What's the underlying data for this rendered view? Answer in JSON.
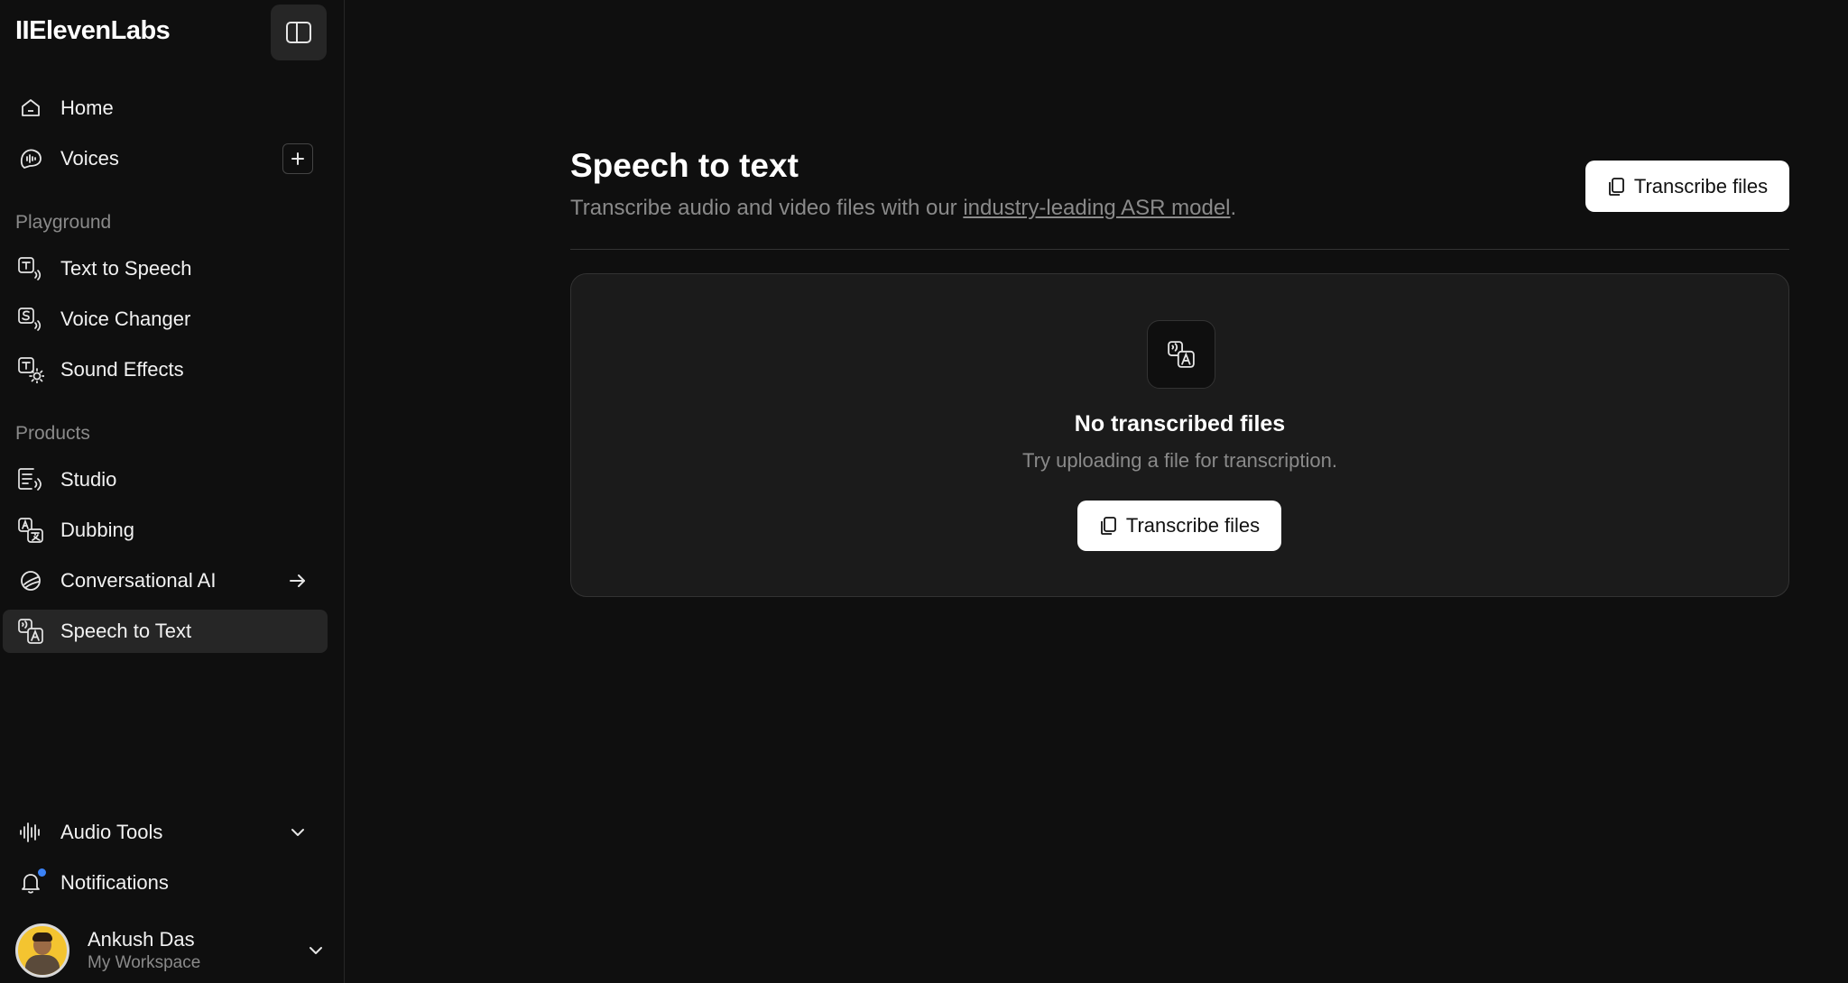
{
  "app": {
    "logo": "IIElevenLabs"
  },
  "sidebar": {
    "items": [
      {
        "label": "Home",
        "icon": "home-icon"
      },
      {
        "label": "Voices",
        "icon": "voices-icon",
        "trail": "plus-icon"
      }
    ],
    "sections": [
      {
        "title": "Playground",
        "items": [
          {
            "label": "Text to Speech",
            "icon": "text-to-speech-icon"
          },
          {
            "label": "Voice Changer",
            "icon": "voice-changer-icon"
          },
          {
            "label": "Sound Effects",
            "icon": "sound-effects-icon"
          }
        ]
      },
      {
        "title": "Products",
        "items": [
          {
            "label": "Studio",
            "icon": "studio-icon"
          },
          {
            "label": "Dubbing",
            "icon": "dubbing-icon"
          },
          {
            "label": "Conversational AI",
            "icon": "conversational-ai-icon",
            "trail": "arrow-right-icon"
          },
          {
            "label": "Speech to Text",
            "icon": "speech-to-text-icon",
            "active": true
          }
        ]
      }
    ],
    "bottom": [
      {
        "label": "Audio Tools",
        "icon": "audio-tools-icon",
        "trail": "chevron-down-icon"
      },
      {
        "label": "Notifications",
        "icon": "bell-icon",
        "badge_color": "#3b82f6"
      }
    ],
    "user": {
      "name": "Ankush Das",
      "workspace": "My Workspace"
    }
  },
  "main": {
    "title": "Speech to text",
    "subtitle_prefix": "Transcribe audio and video files with our ",
    "subtitle_link": "industry-leading ASR model",
    "subtitle_suffix": ".",
    "header_button": "Transcribe files",
    "empty_state": {
      "title": "No transcribed files",
      "subtitle": "Try uploading a file for transcription.",
      "button": "Transcribe files"
    }
  },
  "colors": {
    "background": "#0f0f0f",
    "panel": "#1b1b1b",
    "active_nav": "#262626",
    "muted_text": "#8a8a8a",
    "button_bg": "#ffffff"
  }
}
